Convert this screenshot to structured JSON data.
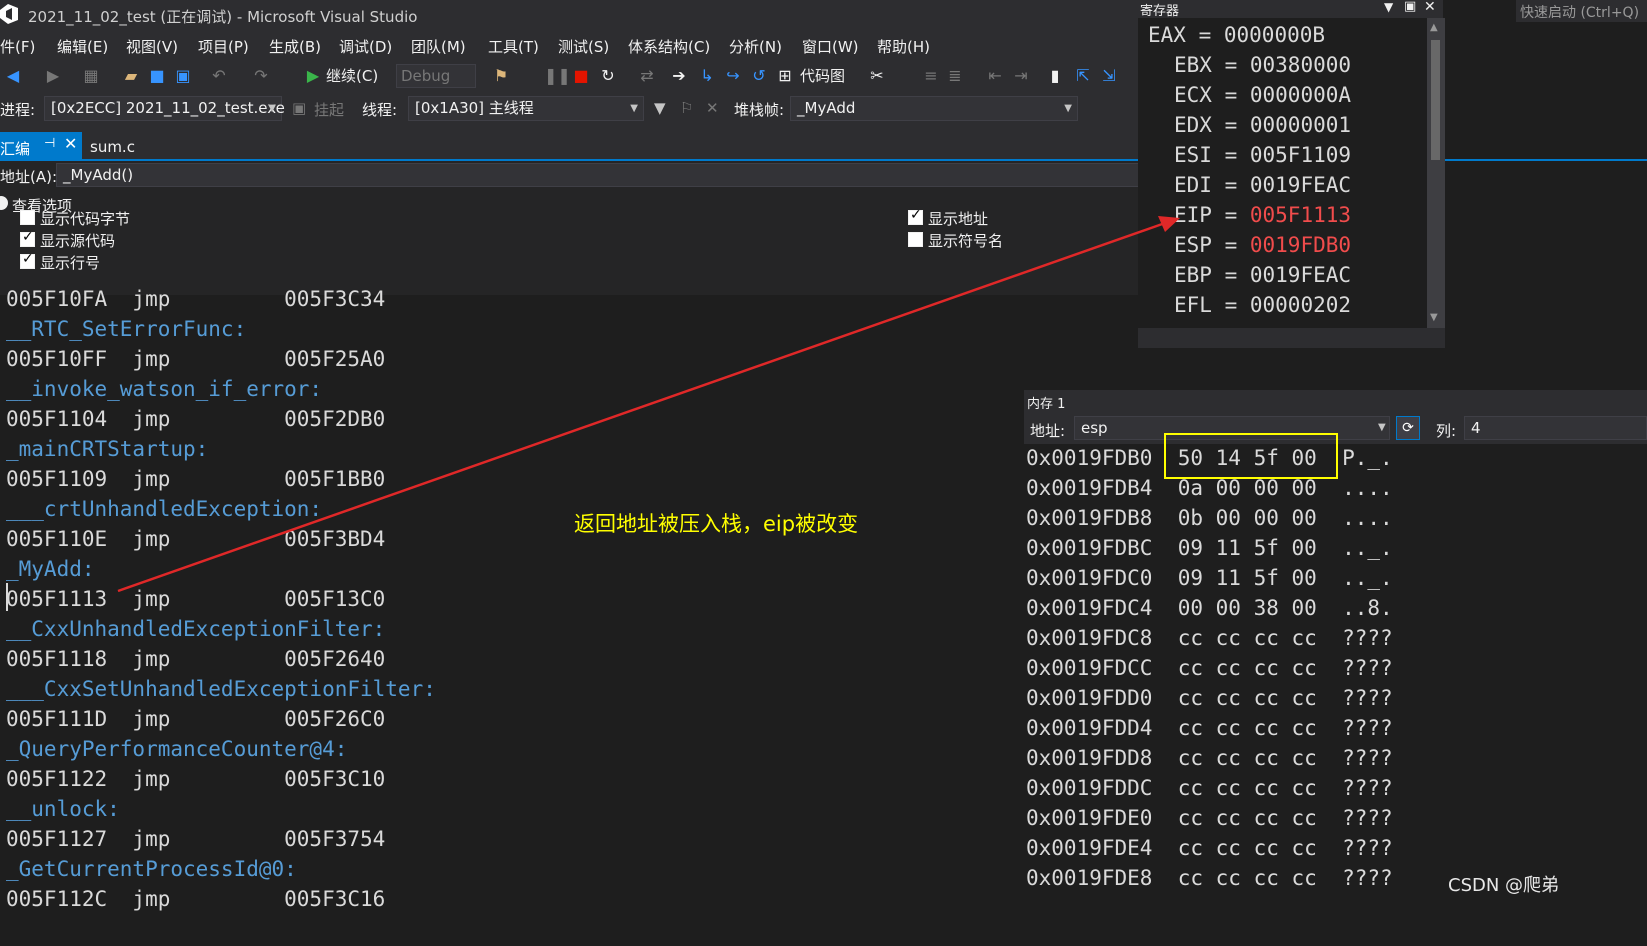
{
  "window": {
    "title": "2021_11_02_test (正在调试) - Microsoft Visual Studio",
    "quick_launch": "快速启动 (Ctrl+Q)"
  },
  "menu": [
    "件(F)",
    "编辑(E)",
    "视图(V)",
    "项目(P)",
    "生成(B)",
    "调试(D)",
    "团队(M)",
    "工具(T)",
    "测试(S)",
    "体系结构(C)",
    "分析(N)",
    "窗口(W)",
    "帮助(H)"
  ],
  "toolbar": {
    "continue_label": "继续(C)",
    "config": "Debug",
    "code_map": "代码图"
  },
  "debug_bar": {
    "process_label": "进程:",
    "process_value": "[0x2ECC] 2021_11_02_test.exe",
    "suspend_label": "挂起",
    "thread_label": "线程:",
    "thread_value": "[0x1A30] 主线程",
    "stack_label": "堆栈帧:",
    "stack_value": "_MyAdd"
  },
  "tabs": {
    "disasm": "汇编",
    "source": "sum.c"
  },
  "address": {
    "label": "地址(A):",
    "value": "_MyAdd()"
  },
  "view_options": {
    "header": "查看选项",
    "show_code_bytes": "显示代码字节",
    "show_source": "显示源代码",
    "show_line_numbers": "显示行号",
    "show_address": "显示地址",
    "show_symbol_names": "显示符号名"
  },
  "disasm_lines": [
    "005F10FA  jmp         005F3C34",
    "__RTC_SetErrorFunc:",
    "005F10FF  jmp         005F25A0",
    "__invoke_watson_if_error:",
    "005F1104  jmp         005F2DB0",
    "_mainCRTStartup:",
    "005F1109  jmp         005F1BB0",
    "___crtUnhandledException:",
    "005F110E  jmp         005F3BD4",
    "_MyAdd:",
    "005F1113  jmp         005F13C0",
    "__CxxUnhandledExceptionFilter:",
    "005F1118  jmp         005F2640",
    "___CxxSetUnhandledExceptionFilter:",
    "005F111D  jmp         005F26C0",
    "_QueryPerformanceCounter@4:",
    "005F1122  jmp         005F3C10",
    "__unlock:",
    "005F1127  jmp         005F3754",
    "_GetCurrentProcessId@0:",
    "005F112C  jmp         005F3C16"
  ],
  "registers": {
    "title": "寄存器",
    "rows": [
      {
        "name": "EAX",
        "value": "0000000B",
        "changed": false
      },
      {
        "name": "EBX",
        "value": "00380000",
        "changed": false
      },
      {
        "name": "ECX",
        "value": "0000000A",
        "changed": false
      },
      {
        "name": "EDX",
        "value": "00000001",
        "changed": false
      },
      {
        "name": "ESI",
        "value": "005F1109",
        "changed": false
      },
      {
        "name": "EDI",
        "value": "0019FEAC",
        "changed": false
      },
      {
        "name": "EIP",
        "value": "005F1113",
        "changed": true
      },
      {
        "name": "ESP",
        "value": "0019FDB0",
        "changed": true
      },
      {
        "name": "EBP",
        "value": "0019FEAC",
        "changed": false
      },
      {
        "name": "EFL",
        "value": "00000202",
        "changed": false
      }
    ]
  },
  "memory": {
    "title": "内存 1",
    "address_label": "地址:",
    "address_value": "esp",
    "columns_label": "列:",
    "columns_value": "4",
    "rows": [
      {
        "addr": "0x0019FDB0",
        "bytes": "50 14 5f 00",
        "ascii": "P._."
      },
      {
        "addr": "0x0019FDB4",
        "bytes": "0a 00 00 00",
        "ascii": "...."
      },
      {
        "addr": "0x0019FDB8",
        "bytes": "0b 00 00 00",
        "ascii": "...."
      },
      {
        "addr": "0x0019FDBC",
        "bytes": "09 11 5f 00",
        "ascii": ".._."
      },
      {
        "addr": "0x0019FDC0",
        "bytes": "09 11 5f 00",
        "ascii": ".._."
      },
      {
        "addr": "0x0019FDC4",
        "bytes": "00 00 38 00",
        "ascii": "..8."
      },
      {
        "addr": "0x0019FDC8",
        "bytes": "cc cc cc cc",
        "ascii": "????"
      },
      {
        "addr": "0x0019FDCC",
        "bytes": "cc cc cc cc",
        "ascii": "????"
      },
      {
        "addr": "0x0019FDD0",
        "bytes": "cc cc cc cc",
        "ascii": "????"
      },
      {
        "addr": "0x0019FDD4",
        "bytes": "cc cc cc cc",
        "ascii": "????"
      },
      {
        "addr": "0x0019FDD8",
        "bytes": "cc cc cc cc",
        "ascii": "????"
      },
      {
        "addr": "0x0019FDDC",
        "bytes": "cc cc cc cc",
        "ascii": "????"
      },
      {
        "addr": "0x0019FDE0",
        "bytes": "cc cc cc cc",
        "ascii": "????"
      },
      {
        "addr": "0x0019FDE4",
        "bytes": "cc cc cc cc",
        "ascii": "????"
      },
      {
        "addr": "0x0019FDE8",
        "bytes": "cc cc cc cc",
        "ascii": "????"
      }
    ]
  },
  "annotation": "返回地址被压入栈，eip被改变",
  "watermark": "CSDN @爬弟",
  "colors": {
    "accent": "#007acc",
    "symbol": "#569cd6",
    "changed_register": "#f14c4c",
    "annotation": "#ffff00",
    "arrow": "#e02828"
  }
}
